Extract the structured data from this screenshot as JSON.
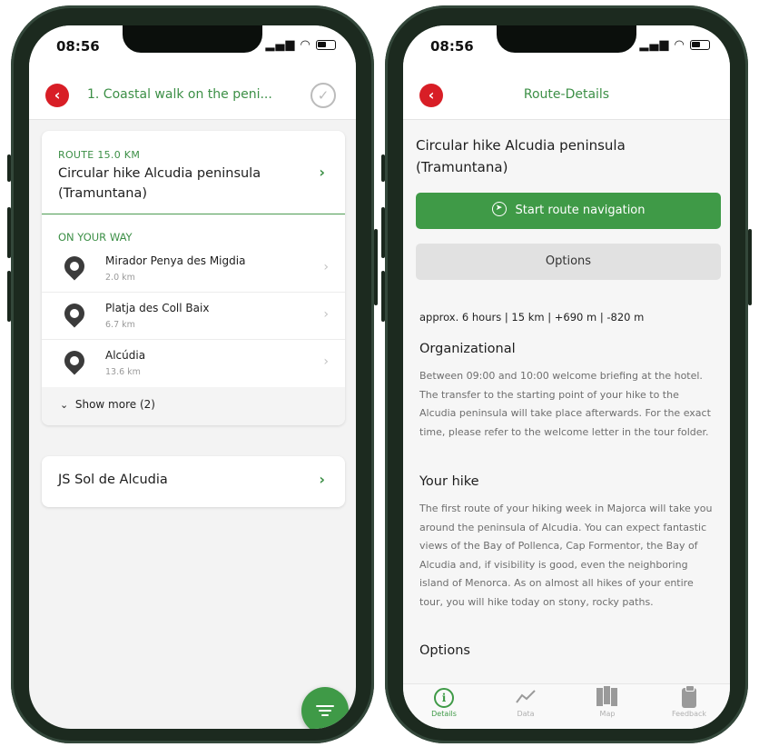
{
  "status": {
    "time": "08:56"
  },
  "screen1": {
    "nav_title": "1. Coastal walk on the peni...",
    "route": {
      "kicker": "ROUTE 15.0 KM",
      "name": "Circular hike Alcudia peninsula (Tramuntana)"
    },
    "on_your_way_title": "ON YOUR WAY",
    "pois": [
      {
        "name": "Mirador Penya des Migdia",
        "distance": "2.0 km"
      },
      {
        "name": "Platja des Coll Baix",
        "distance": "6.7 km"
      },
      {
        "name": "Alcúdia",
        "distance": "13.6 km"
      }
    ],
    "show_more": "Show more (2)",
    "hotel": "JS Sol de Alcudia"
  },
  "screen2": {
    "nav_title": "Route-Details",
    "title": "Circular hike Alcudia peninsula (Tramuntana)",
    "start_button": "Start route navigation",
    "options_button": "Options",
    "stats": "approx. 6 hours | 15 km | +690 m | -820 m",
    "organizational_heading": "Organizational",
    "organizational_text": "Between 09:00 and 10:00 welcome briefing at the hotel. The transfer to the starting point of your hike to the Alcudia peninsula will take place afterwards. For the exact time, please refer to the welcome letter in the tour folder.",
    "your_hike_heading": "Your hike",
    "your_hike_text": "The first route of your hiking week in Majorca will take you around the peninsula of Alcudia. You can expect fantastic views of the Bay of Pollenca, Cap Formentor, the Bay of Alcudia and, if visibility is good, even the neighboring island of Menorca. As on almost all hikes of your entire tour, you will hike today on stony, rocky paths.",
    "options_heading": "Options",
    "tabs": [
      {
        "label": "Details",
        "icon": "info-icon"
      },
      {
        "label": "Data",
        "icon": "chart-line-icon"
      },
      {
        "label": "Map",
        "icon": "map-icon"
      },
      {
        "label": "Feedback",
        "icon": "clipboard-icon"
      }
    ]
  },
  "colors": {
    "accent_green": "#3f9a47",
    "back_red": "#d81e26",
    "frame": "#1c2a1f"
  }
}
